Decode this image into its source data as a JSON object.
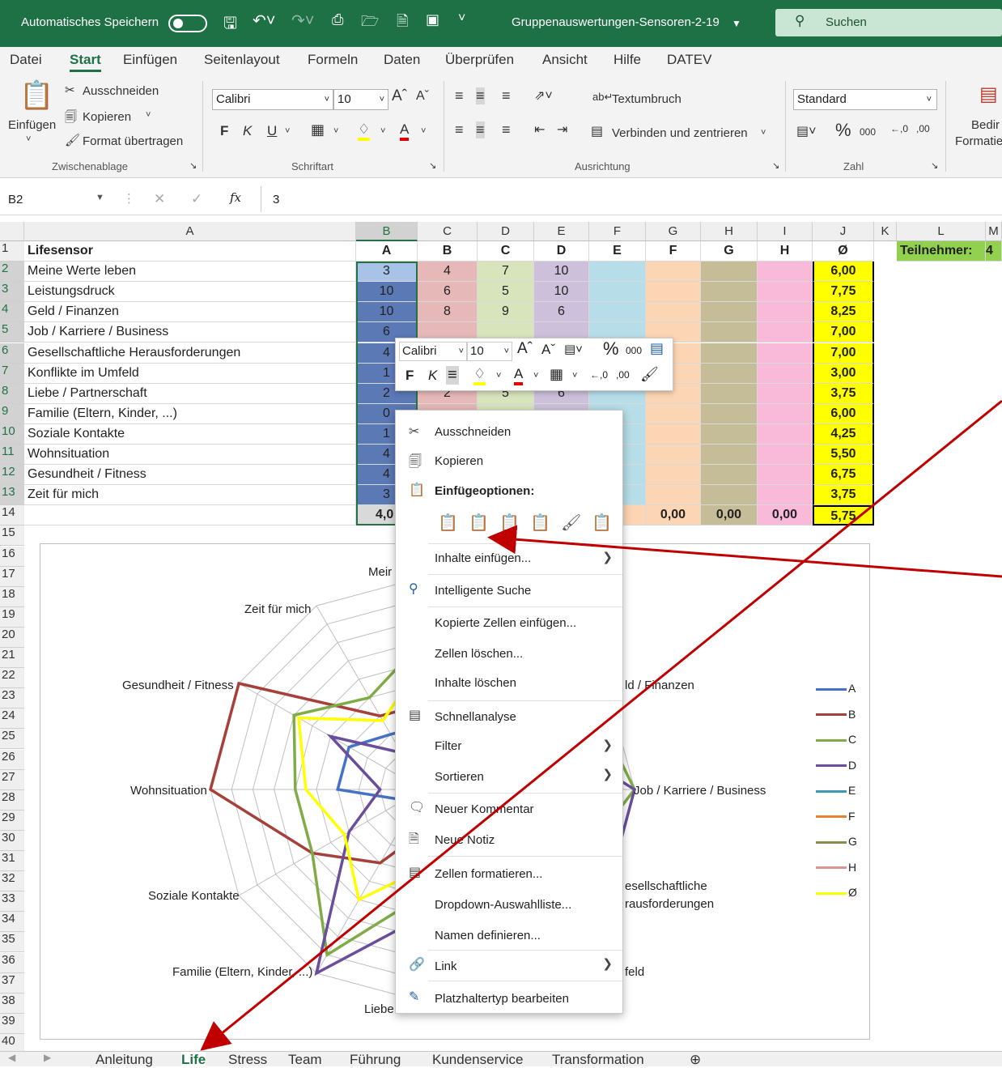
{
  "titlebar": {
    "autosave_label": "Automatisches Speichern",
    "filename": "Gruppenauswertungen-Sensoren-2-19",
    "search_placeholder": "Suchen"
  },
  "menu": [
    "Datei",
    "Start",
    "Einfügen",
    "Seitenlayout",
    "Formeln",
    "Daten",
    "Überprüfen",
    "Ansicht",
    "Hilfe",
    "DATEV"
  ],
  "ribbon": {
    "paste": "Einfügen",
    "cut": "Ausschneiden",
    "copy": "Kopieren",
    "format_painter": "Format übertragen",
    "group_clipboard": "Zwischenablage",
    "font_name": "Calibri",
    "font_size": "10",
    "bold": "F",
    "italic": "K",
    "underline": "U",
    "group_font": "Schriftart",
    "wrap_text": "Textumbruch",
    "merge_center": "Verbinden und zentrieren",
    "group_alignment": "Ausrichtung",
    "number_format": "Standard",
    "percent": "%",
    "thousands": "000",
    "group_number": "Zahl",
    "cond_format_1": "Bedir",
    "cond_format_2": "Formatie"
  },
  "formula_bar": {
    "name_box": "B2",
    "fx": "fx",
    "value": "3"
  },
  "columns": [
    "A",
    "B",
    "C",
    "D",
    "E",
    "F",
    "G",
    "H",
    "I",
    "J",
    "K",
    "L",
    "M"
  ],
  "rows": {
    "header": [
      "Lifesensor",
      "A",
      "B",
      "C",
      "D",
      "E",
      "F",
      "G",
      "H",
      "Ø"
    ],
    "teilnehmer_label": "Teilnehmer:",
    "teilnehmer_value": "4",
    "data": [
      {
        "label": "Meine Werte leben",
        "b": "3",
        "c": "4",
        "d": "7",
        "e": "10",
        "j": "6,00"
      },
      {
        "label": "Leistungsdruck",
        "b": "10",
        "c": "6",
        "d": "5",
        "e": "10",
        "j": "7,75"
      },
      {
        "label": "Geld / Finanzen",
        "b": "10",
        "c": "8",
        "d": "9",
        "e": "6",
        "j": "8,25"
      },
      {
        "label": "Job / Karriere / Business",
        "b": "6",
        "c": "",
        "d": "",
        "e": "",
        "j": "7,00"
      },
      {
        "label": "Gesellschaftliche Herausforderungen",
        "b": "4",
        "c": "",
        "d": "",
        "e": "",
        "j": "7,00"
      },
      {
        "label": "Konflikte im Umfeld",
        "b": "1",
        "c": "",
        "d": "",
        "e": "",
        "j": "3,00"
      },
      {
        "label": "Liebe / Partnerschaft",
        "b": "2",
        "c": "2",
        "d": "5",
        "e": "6",
        "j": "3,75"
      },
      {
        "label": "Familie (Eltern, Kinder, ...)",
        "b": "0",
        "c": "",
        "d": "",
        "e": "",
        "j": "6,00"
      },
      {
        "label": "Soziale Kontakte",
        "b": "1",
        "c": "",
        "d": "",
        "e": "",
        "j": "4,25"
      },
      {
        "label": "Wohnsituation",
        "b": "4",
        "c": "",
        "d": "",
        "e": "",
        "j": "5,50"
      },
      {
        "label": "Gesundheit / Fitness",
        "b": "4",
        "c": "",
        "d": "",
        "e": "",
        "j": "6,75"
      },
      {
        "label": "Zeit für mich",
        "b": "3",
        "c": "",
        "d": "",
        "e": "",
        "j": "3,75"
      }
    ],
    "totals": {
      "b": "4,0",
      "f": "0,00",
      "g": "0,00",
      "h": "0,00",
      "i": "0,00",
      "j": "5,75",
      "e_partial": "0"
    }
  },
  "row_numbers": [
    "1",
    "2",
    "3",
    "4",
    "5",
    "6",
    "7",
    "8",
    "9",
    "10",
    "11",
    "12",
    "13",
    "14",
    "15",
    "16",
    "17",
    "18",
    "19",
    "20",
    "21",
    "22",
    "23",
    "24",
    "25",
    "26",
    "27",
    "28",
    "29",
    "30",
    "31",
    "32",
    "33",
    "34",
    "35",
    "36",
    "37",
    "38",
    "39",
    "40"
  ],
  "chart": {
    "axis_labels": {
      "top": "Meir",
      "zeit": "Zeit für mich",
      "gesundheit": "Gesundheit / Fitness",
      "wohn": "Wohnsituation",
      "sozial": "Soziale Kontakte",
      "familie": "Familie (Eltern, Kinder, ...)",
      "liebe": "Liebe",
      "geld": "ld / Finanzen",
      "job": "Job / Karriere / Business",
      "ges1": "esellschaftliche",
      "ges2": "rausforderungen",
      "umfeld": "feld"
    },
    "legend": [
      {
        "name": "A",
        "color": "#4472c4"
      },
      {
        "name": "B",
        "color": "#a5403a"
      },
      {
        "name": "C",
        "color": "#7fac46"
      },
      {
        "name": "D",
        "color": "#6a4e9c"
      },
      {
        "name": "E",
        "color": "#3c9ab5"
      },
      {
        "name": "F",
        "color": "#e8822e"
      },
      {
        "name": "G",
        "color": "#8b8b4e"
      },
      {
        "name": "H",
        "color": "#d99694"
      },
      {
        "name": "Ø",
        "color": "#ffff00"
      }
    ]
  },
  "mini_toolbar": {
    "font": "Calibri",
    "size": "10",
    "bold": "F",
    "italic": "K",
    "percent": "%",
    "thousands": "000"
  },
  "context_menu": {
    "cut": "Ausschneiden",
    "copy": "Kopieren",
    "paste_options": "Einfügeoptionen:",
    "paste_special": "Inhalte einfügen...",
    "smart_lookup": "Intelligente Suche",
    "insert_copied": "Kopierte Zellen einfügen...",
    "delete_cells": "Zellen löschen...",
    "clear_contents": "Inhalte löschen",
    "quick_analysis": "Schnellanalyse",
    "filter": "Filter",
    "sort": "Sortieren",
    "new_comment": "Neuer Kommentar",
    "new_note": "Neue Notiz",
    "format_cells": "Zellen formatieren...",
    "dropdown": "Dropdown-Auswahlliste...",
    "define_name": "Namen definieren...",
    "link": "Link",
    "placeholder": "Platzhaltertyp bearbeiten"
  },
  "sheet_tabs": [
    "Anleitung",
    "Life",
    "Stress",
    "Team",
    "Führung",
    "Kundenservice",
    "Transformation"
  ],
  "colors": {
    "excel_green": "#1e7145",
    "selection_green": "#217346",
    "annotation_arrow": "#c00000"
  }
}
